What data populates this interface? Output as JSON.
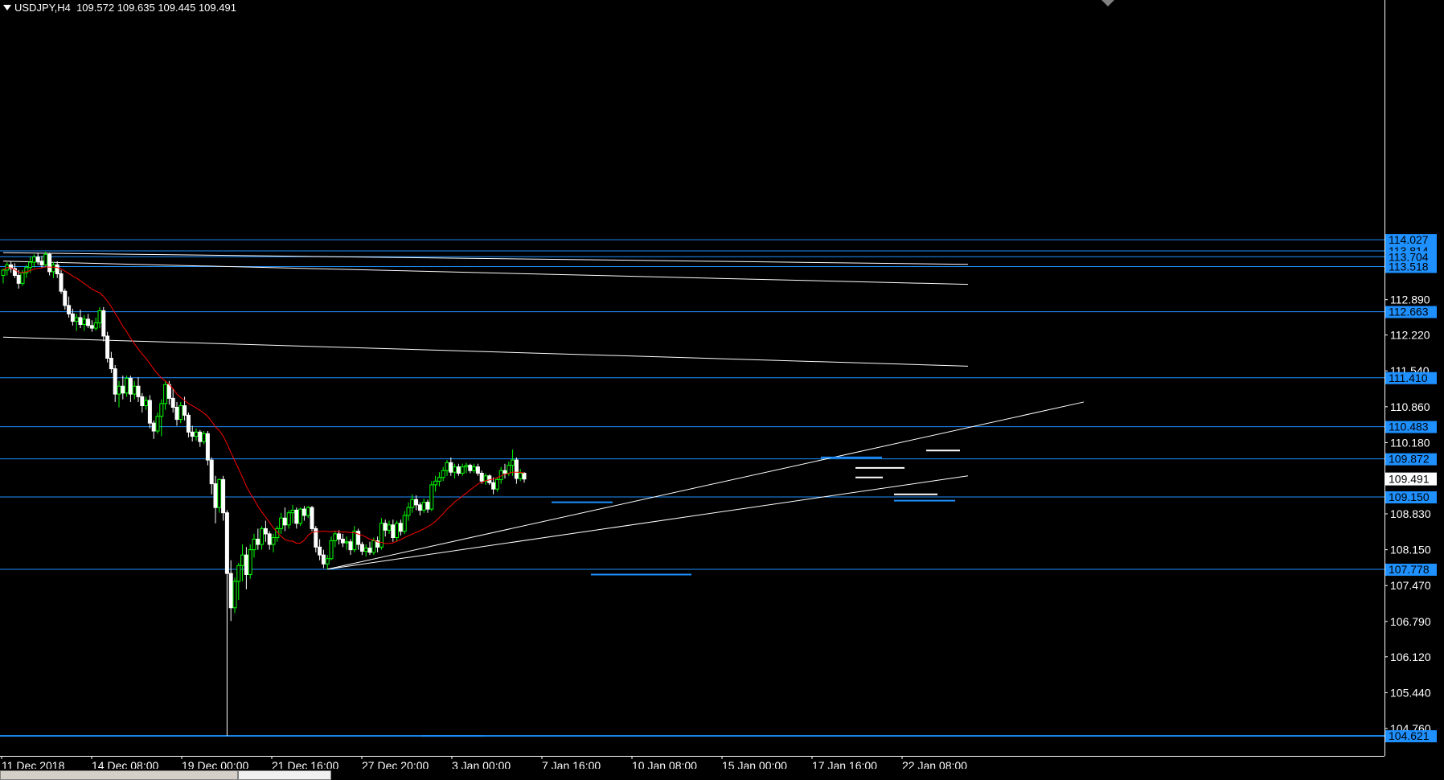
{
  "header": {
    "symbol": "USDJPY,H4",
    "open": "109.572",
    "high": "109.635",
    "low": "109.445",
    "close": "109.491"
  },
  "colors": {
    "background": "#000000",
    "bull_candle": "#00ff00",
    "bear_candle": "#ffffff",
    "moving_average": "#ff0000",
    "horizontal_level": "#1e90ff",
    "trendline": "#ffffff",
    "axis_text": "#ffffff",
    "price_tag_bg": "#1e90ff",
    "current_price_tag_bg": "#ffffff"
  },
  "chart_data": {
    "type": "candlestick",
    "symbol": "USDJPY",
    "timeframe": "H4",
    "y_range": [
      104.4,
      114.2
    ],
    "x_tick_labels": [
      "11 Dec 2018",
      "14 Dec 08:00",
      "19 Dec 00:00",
      "21 Dec 16:00",
      "27 Dec 20:00",
      "3 Jan 00:00",
      "7 Jan 16:00",
      "10 Jan 08:00",
      "15 Jan 00:00",
      "17 Jan 16:00",
      "22 Jan 08:00"
    ],
    "y_tick_labels": [
      "112.890",
      "112.220",
      "111.540",
      "110.860",
      "110.180",
      "108.830",
      "108.150",
      "107.470",
      "106.790",
      "106.120",
      "105.440",
      "104.760"
    ],
    "horizontal_levels": [
      "114.027",
      "113.814",
      "113.704",
      "113.518",
      "112.663",
      "111.410",
      "110.483",
      "109.872",
      "109.150",
      "107.778",
      "104.621"
    ],
    "current_price": "109.491",
    "candles": [
      [
        113.35,
        113.48,
        113.2,
        113.45
      ],
      [
        113.45,
        113.6,
        113.35,
        113.55
      ],
      [
        113.55,
        113.62,
        113.4,
        113.48
      ],
      [
        113.48,
        113.58,
        113.3,
        113.35
      ],
      [
        113.35,
        113.45,
        113.1,
        113.2
      ],
      [
        113.2,
        113.45,
        113.15,
        113.4
      ],
      [
        113.4,
        113.55,
        113.3,
        113.5
      ],
      [
        113.5,
        113.7,
        113.4,
        113.6
      ],
      [
        113.6,
        113.75,
        113.5,
        113.7
      ],
      [
        113.7,
        113.78,
        113.55,
        113.62
      ],
      [
        113.62,
        113.72,
        113.5,
        113.55
      ],
      [
        113.55,
        113.8,
        113.5,
        113.75
      ],
      [
        113.75,
        113.78,
        113.35,
        113.42
      ],
      [
        113.42,
        113.6,
        113.3,
        113.55
      ],
      [
        113.55,
        113.62,
        113.3,
        113.38
      ],
      [
        113.38,
        113.45,
        113.0,
        113.05
      ],
      [
        113.05,
        113.1,
        112.7,
        112.78
      ],
      [
        112.78,
        112.95,
        112.55,
        112.62
      ],
      [
        112.62,
        112.72,
        112.4,
        112.48
      ],
      [
        112.48,
        112.62,
        112.3,
        112.55
      ],
      [
        112.55,
        112.7,
        112.35,
        112.42
      ],
      [
        112.42,
        112.6,
        112.3,
        112.52
      ],
      [
        112.52,
        112.62,
        112.35,
        112.4
      ],
      [
        112.4,
        112.5,
        112.28,
        112.35
      ],
      [
        112.35,
        112.55,
        112.3,
        112.45
      ],
      [
        112.45,
        112.75,
        112.35,
        112.68
      ],
      [
        112.68,
        112.75,
        112.1,
        112.2
      ],
      [
        112.2,
        112.28,
        111.7,
        111.78
      ],
      [
        111.78,
        111.9,
        111.5,
        111.58
      ],
      [
        111.58,
        111.65,
        110.95,
        111.1
      ],
      [
        111.1,
        111.35,
        110.85,
        111.25
      ],
      [
        111.25,
        111.45,
        111.0,
        111.12
      ],
      [
        111.12,
        111.45,
        111.05,
        111.4
      ],
      [
        111.4,
        111.45,
        110.95,
        111.1
      ],
      [
        111.1,
        111.35,
        111.0,
        111.25
      ],
      [
        111.25,
        111.42,
        110.95,
        111.05
      ],
      [
        111.05,
        111.12,
        110.75,
        110.88
      ],
      [
        110.88,
        111.05,
        110.8,
        110.98
      ],
      [
        110.98,
        111.08,
        110.45,
        110.55
      ],
      [
        110.55,
        110.6,
        110.25,
        110.4
      ],
      [
        110.4,
        110.75,
        110.35,
        110.68
      ],
      [
        110.68,
        111.0,
        110.3,
        110.92
      ],
      [
        110.92,
        111.35,
        110.8,
        111.28
      ],
      [
        111.28,
        111.35,
        110.9,
        111.02
      ],
      [
        111.02,
        111.2,
        110.75,
        110.85
      ],
      [
        110.85,
        110.95,
        110.5,
        110.62
      ],
      [
        110.62,
        110.95,
        110.55,
        110.88
      ],
      [
        110.88,
        111.05,
        110.6,
        110.7
      ],
      [
        110.7,
        110.75,
        110.28,
        110.38
      ],
      [
        110.38,
        110.5,
        110.2,
        110.3
      ],
      [
        110.3,
        110.45,
        110.22,
        110.38
      ],
      [
        110.38,
        110.42,
        110.1,
        110.2
      ],
      [
        110.2,
        110.4,
        110.15,
        110.35
      ],
      [
        110.35,
        110.4,
        109.75,
        109.85
      ],
      [
        109.85,
        109.9,
        109.2,
        109.4
      ],
      [
        109.4,
        109.55,
        108.65,
        108.95
      ],
      [
        108.95,
        109.5,
        108.85,
        109.48
      ],
      [
        109.48,
        109.55,
        108.7,
        108.85
      ],
      [
        108.85,
        108.9,
        104.62,
        107.7
      ],
      [
        107.7,
        107.95,
        106.8,
        107.05
      ],
      [
        107.05,
        107.62,
        106.95,
        107.55
      ],
      [
        107.55,
        107.9,
        107.2,
        107.85
      ],
      [
        107.85,
        108.25,
        107.55,
        108.05
      ],
      [
        108.05,
        108.2,
        107.4,
        107.68
      ],
      [
        107.68,
        108.25,
        107.6,
        108.15
      ],
      [
        108.15,
        108.45,
        108.0,
        108.35
      ],
      [
        108.35,
        108.55,
        108.15,
        108.25
      ],
      [
        108.25,
        108.6,
        108.15,
        108.55
      ],
      [
        108.55,
        108.7,
        108.3,
        108.45
      ],
      [
        108.45,
        108.5,
        108.15,
        108.25
      ],
      [
        108.25,
        108.45,
        108.1,
        108.38
      ],
      [
        108.38,
        108.6,
        108.3,
        108.55
      ],
      [
        108.55,
        108.85,
        108.45,
        108.75
      ],
      [
        108.75,
        108.95,
        108.5,
        108.62
      ],
      [
        108.62,
        108.9,
        108.55,
        108.85
      ],
      [
        108.85,
        109.0,
        108.65,
        108.9
      ],
      [
        108.9,
        108.95,
        108.55,
        108.65
      ],
      [
        108.65,
        108.95,
        108.6,
        108.92
      ],
      [
        108.92,
        108.98,
        108.7,
        108.8
      ],
      [
        108.8,
        108.98,
        108.75,
        108.95
      ],
      [
        108.95,
        108.98,
        108.5,
        108.55
      ],
      [
        108.55,
        108.6,
        108.1,
        108.2
      ],
      [
        108.2,
        108.35,
        107.95,
        108.05
      ],
      [
        108.05,
        108.15,
        107.8,
        107.88
      ],
      [
        107.88,
        108.05,
        107.78,
        107.98
      ],
      [
        107.98,
        108.4,
        107.95,
        108.32
      ],
      [
        108.32,
        108.5,
        108.2,
        108.45
      ],
      [
        108.45,
        108.52,
        108.25,
        108.35
      ],
      [
        108.35,
        108.45,
        108.2,
        108.28
      ],
      [
        108.28,
        108.4,
        108.15,
        108.3
      ],
      [
        108.3,
        108.35,
        108.05,
        108.15
      ],
      [
        108.15,
        108.6,
        108.1,
        108.5
      ],
      [
        108.5,
        108.55,
        108.15,
        108.25
      ],
      [
        108.25,
        108.3,
        108.05,
        108.12
      ],
      [
        108.12,
        108.25,
        108.02,
        108.18
      ],
      [
        108.18,
        108.3,
        108.05,
        108.1
      ],
      [
        108.1,
        108.38,
        108.05,
        108.32
      ],
      [
        108.32,
        108.4,
        108.1,
        108.2
      ],
      [
        108.2,
        108.75,
        108.15,
        108.65
      ],
      [
        108.65,
        108.72,
        108.4,
        108.52
      ],
      [
        108.52,
        108.7,
        108.45,
        108.62
      ],
      [
        108.62,
        108.72,
        108.3,
        108.38
      ],
      [
        108.38,
        108.7,
        108.3,
        108.65
      ],
      [
        108.65,
        108.72,
        108.42,
        108.5
      ],
      [
        108.5,
        108.88,
        108.45,
        108.8
      ],
      [
        108.8,
        109.05,
        108.7,
        108.95
      ],
      [
        108.95,
        109.2,
        108.85,
        109.1
      ],
      [
        109.1,
        109.18,
        108.9,
        109.0
      ],
      [
        109.0,
        109.05,
        108.8,
        108.9
      ],
      [
        108.9,
        109.12,
        108.85,
        109.05
      ],
      [
        109.05,
        109.1,
        108.85,
        108.92
      ],
      [
        108.92,
        109.45,
        108.88,
        109.38
      ],
      [
        109.38,
        109.55,
        109.25,
        109.45
      ],
      [
        109.45,
        109.62,
        109.35,
        109.52
      ],
      [
        109.52,
        109.72,
        109.45,
        109.65
      ],
      [
        109.65,
        109.85,
        109.55,
        109.8
      ],
      [
        109.8,
        109.9,
        109.55,
        109.62
      ],
      [
        109.62,
        109.78,
        109.5,
        109.72
      ],
      [
        109.72,
        109.78,
        109.55,
        109.6
      ],
      [
        109.6,
        109.78,
        109.55,
        109.72
      ],
      [
        109.72,
        109.8,
        109.6,
        109.75
      ],
      [
        109.75,
        109.78,
        109.6,
        109.65
      ],
      [
        109.65,
        109.78,
        109.6,
        109.72
      ],
      [
        109.72,
        109.78,
        109.55,
        109.6
      ],
      [
        109.6,
        109.65,
        109.4,
        109.45
      ],
      [
        109.45,
        109.6,
        109.38,
        109.55
      ],
      [
        109.55,
        109.58,
        109.38,
        109.42
      ],
      [
        109.42,
        109.52,
        109.2,
        109.3
      ],
      [
        109.3,
        109.52,
        109.25,
        109.48
      ],
      [
        109.48,
        109.72,
        109.4,
        109.65
      ],
      [
        109.65,
        109.78,
        109.5,
        109.6
      ],
      [
        109.6,
        109.82,
        109.55,
        109.75
      ],
      [
        109.75,
        110.05,
        109.55,
        109.85
      ],
      [
        109.85,
        109.9,
        109.4,
        109.5
      ],
      [
        109.5,
        109.68,
        109.45,
        109.6
      ],
      [
        109.6,
        109.62,
        109.42,
        109.49
      ]
    ]
  }
}
